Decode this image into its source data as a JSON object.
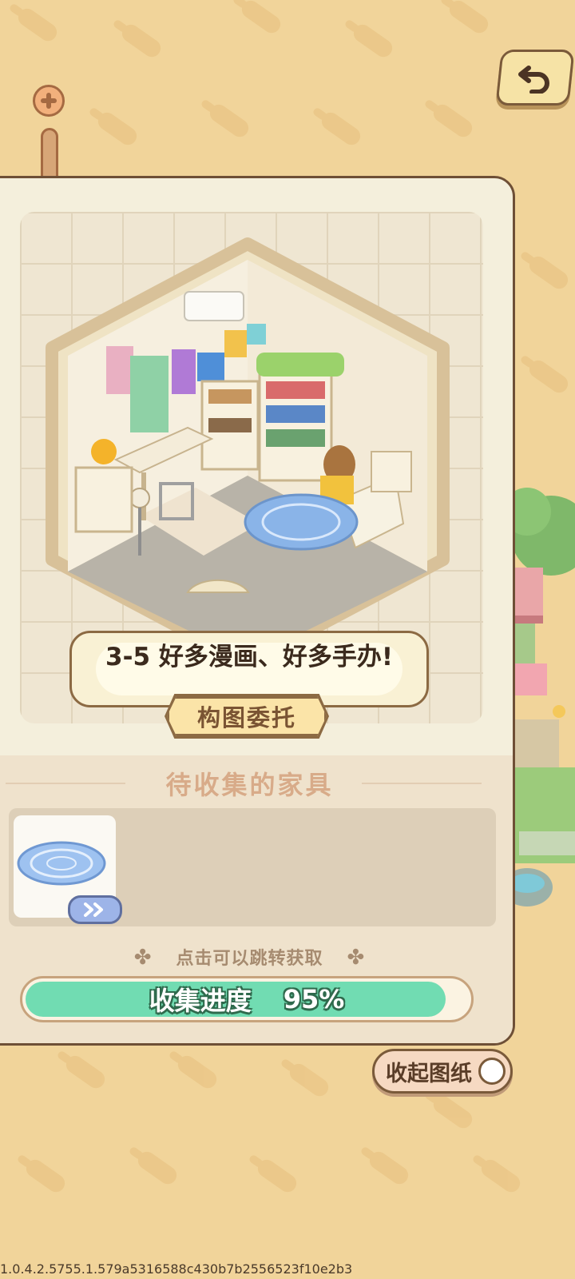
{
  "level_title": "3-5 好多漫画、好多手办!",
  "tag_label": "构图委托",
  "section_title": "待收集的家具",
  "hint_text": "点击可以跳转获取",
  "progress": {
    "label": "收集进度",
    "percent_text": "95%",
    "value": 0.95
  },
  "collapse_label": "收起图纸",
  "version": "1.0.4.2.5755.1.579a5316588c430b7b2556523f10e2b3",
  "icons": {
    "back": "undo-arrow-icon",
    "zoom": "plus-icon",
    "item": "blue-rug-icon",
    "jump": "double-chevron-right-icon",
    "hint_deco": "clover-icon"
  },
  "colors": {
    "background": "#f1d49a",
    "card": "#f4efdc",
    "progress_fill": "#71dcb2",
    "tag": "#fbe4a8"
  }
}
